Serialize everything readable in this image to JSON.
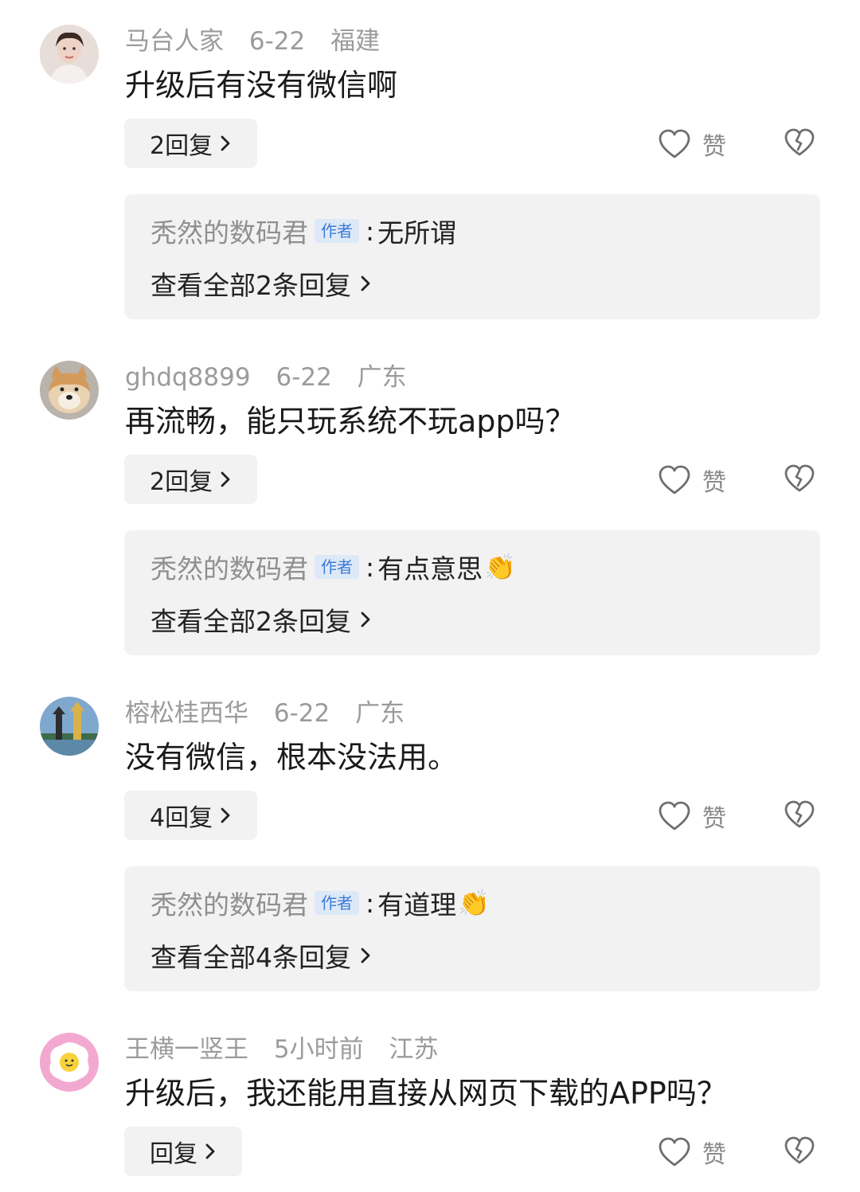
{
  "comments": [
    {
      "username": "马台人家",
      "date": "6-22",
      "location": "福建",
      "text": "升级后有没有微信啊",
      "reply_count_label": "2回复",
      "like_label": "赞",
      "avatar_icon": "portrait-avatar",
      "author_reply": {
        "author": "秃然的数码君",
        "badge": "作者",
        "text": "无所谓",
        "emoji": "",
        "view_all": "查看全部2条回复"
      }
    },
    {
      "username": "ghdq8899",
      "date": "6-22",
      "location": "广东",
      "text": "再流畅，能只玩系统不玩app吗？",
      "reply_count_label": "2回复",
      "like_label": "赞",
      "avatar_icon": "shiba-dog-avatar",
      "author_reply": {
        "author": "秃然的数码君",
        "badge": "作者",
        "text": "有点意思",
        "emoji": "👏",
        "view_all": "查看全部2条回复"
      }
    },
    {
      "username": "榕松桂西华",
      "date": "6-22",
      "location": "广东",
      "text": "没有微信，根本没法用。",
      "reply_count_label": "4回复",
      "like_label": "赞",
      "avatar_icon": "pagoda-avatar",
      "author_reply": {
        "author": "秃然的数码君",
        "badge": "作者",
        "text": "有道理",
        "emoji": "👏",
        "view_all": "查看全部4条回复"
      }
    },
    {
      "username": "王横一竖王",
      "date": "5小时前",
      "location": "江苏",
      "text": "升级后，我还能用直接从网页下载的APP吗？",
      "reply_count_label": "回复",
      "like_label": "赞",
      "avatar_icon": "fried-egg-avatar"
    }
  ]
}
